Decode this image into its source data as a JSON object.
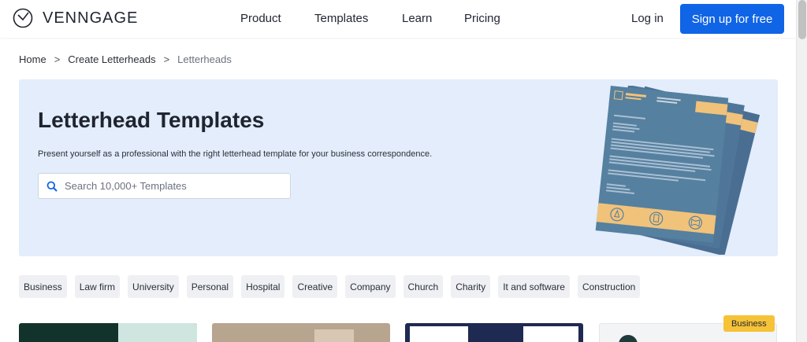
{
  "header": {
    "logo_text": "VENNGAGE",
    "nav": [
      "Product",
      "Templates",
      "Learn",
      "Pricing"
    ],
    "login": "Log in",
    "signup": "Sign up for free"
  },
  "breadcrumb": {
    "home": "Home",
    "sep": ">",
    "parent": "Create Letterheads",
    "current": "Letterheads"
  },
  "hero": {
    "title": "Letterhead Templates",
    "subtitle": "Present yourself as a professional with the right letterhead template for your business correspondence.",
    "search_placeholder": "Search 10,000+ Templates"
  },
  "categories": [
    "Business",
    "Law firm",
    "University",
    "Personal",
    "Hospital",
    "Creative",
    "Company",
    "Church",
    "Charity",
    "It and software",
    "Construction"
  ],
  "cards": {
    "badge": "Business"
  },
  "colors": {
    "accent": "#1064e6",
    "hero_bg": "#e3edfb",
    "badge": "#f6c338"
  }
}
